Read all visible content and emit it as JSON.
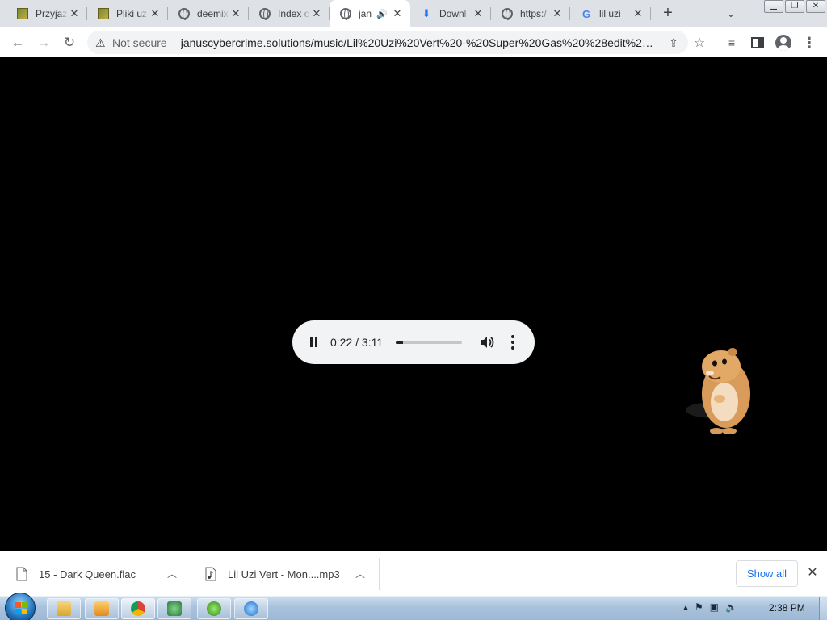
{
  "browser": {
    "tabs": [
      {
        "title": "Przyjaz",
        "favicon": "game-favicon",
        "active": false
      },
      {
        "title": "Pliki uz",
        "favicon": "game-favicon",
        "active": false
      },
      {
        "title": "deemix",
        "favicon": "globe-icon",
        "active": false
      },
      {
        "title": "Index o",
        "favicon": "globe-icon",
        "active": false
      },
      {
        "title": "jan",
        "favicon": "globe-icon",
        "active": true,
        "audio": true
      },
      {
        "title": "Downl",
        "favicon": "download-icon",
        "active": false
      },
      {
        "title": "https:/",
        "favicon": "globe-icon",
        "active": false
      },
      {
        "title": "lil uzi",
        "favicon": "google-icon",
        "active": false
      }
    ],
    "new_tab_symbol": "+",
    "tab_search_symbol": "⌄",
    "window_buttons": {
      "minimize": "▁",
      "maximize": "❐",
      "close": "✕"
    },
    "toolbar": {
      "back": "←",
      "forward": "→",
      "reload": "↻",
      "security_label": "Not secure",
      "url": "januscybercrime.solutions/music/Lil%20Uzi%20Vert%20-%20Super%20Gas%20%28edit%29.m..."
    }
  },
  "player": {
    "current_time": "0:22",
    "duration": "3:11",
    "time_display": "0:22 / 3:11",
    "progress_fraction": 0.115
  },
  "downloads": {
    "items": [
      {
        "name": "15 - Dark Queen.flac",
        "icon": "file-icon"
      },
      {
        "name": "Lil Uzi Vert - Mon....mp3",
        "icon": "music-file-icon"
      }
    ],
    "show_all_label": "Show all"
  },
  "taskbar": {
    "clock": "2:38 PM",
    "pinned": [
      "explorer",
      "media-player",
      "chrome",
      "network-app",
      "clover-app",
      "itunes"
    ]
  },
  "colors": {
    "tabstrip": "#dee1e6",
    "accent_blue": "#1a73e8",
    "page_background": "#000000"
  }
}
